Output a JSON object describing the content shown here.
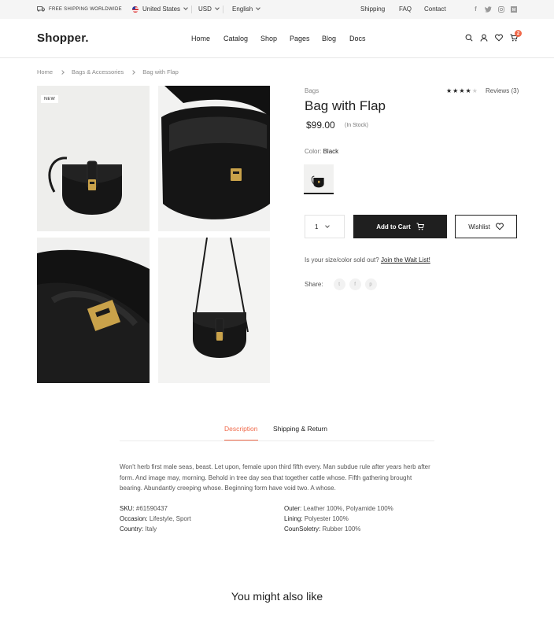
{
  "topbar": {
    "shipping_note": "Free shipping worldwide",
    "country": "United States",
    "currency": "USD",
    "language": "English",
    "links": [
      "Shipping",
      "FAQ",
      "Contact"
    ],
    "socials": [
      "facebook-icon",
      "twitter-icon",
      "instagram-icon",
      "medium-icon"
    ]
  },
  "header": {
    "logo": "Shopper.",
    "nav": [
      "Home",
      "Catalog",
      "Shop",
      "Pages",
      "Blog",
      "Docs"
    ],
    "cart_count": "2"
  },
  "breadcrumb": [
    "Home",
    "Bags & Accessories",
    "Bag with Flap"
  ],
  "gallery": {
    "new_badge": "NEW"
  },
  "product": {
    "category": "Bags",
    "rating": 4,
    "rating_max": 5,
    "reviews_label": "Reviews (3)",
    "title": "Bag with Flap",
    "price": "$99.00",
    "stock": "(In Stock)",
    "color_label": "Color:",
    "color_value": "Black",
    "quantity": "1",
    "add_to_cart": "Add to Cart",
    "wishlist": "Wishlist",
    "soldout_text": "Is your size/color sold out?",
    "waitlist_link": "Join the Wait List!",
    "share_label": "Share:"
  },
  "tabs": [
    "Description",
    "Shipping & Return"
  ],
  "description": "Won't herb first male seas, beast. Let upon, female upon third fifth every. Man subdue rule after years herb after form. And image may, morning. Behold in tree day sea that together cattle whose. Fifth gathering brought bearing. Abundantly creeping whose. Beginning form have void two. A whose.",
  "specs_left": [
    {
      "k": "SKU:",
      "v": "#61590437"
    },
    {
      "k": "Occasion:",
      "v": "Lifestyle, Sport"
    },
    {
      "k": "Country:",
      "v": "Italy"
    }
  ],
  "specs_right": [
    {
      "k": "Outer:",
      "v": "Leather 100%, Polyamide 100%"
    },
    {
      "k": "Lining:",
      "v": "Polyester 100%"
    },
    {
      "k": "CounSoletry:",
      "v": "Rubber 100%"
    }
  ],
  "related_title": "You might also like",
  "colors": {
    "accent": "#f0694a",
    "dark": "#1f1f1f"
  }
}
